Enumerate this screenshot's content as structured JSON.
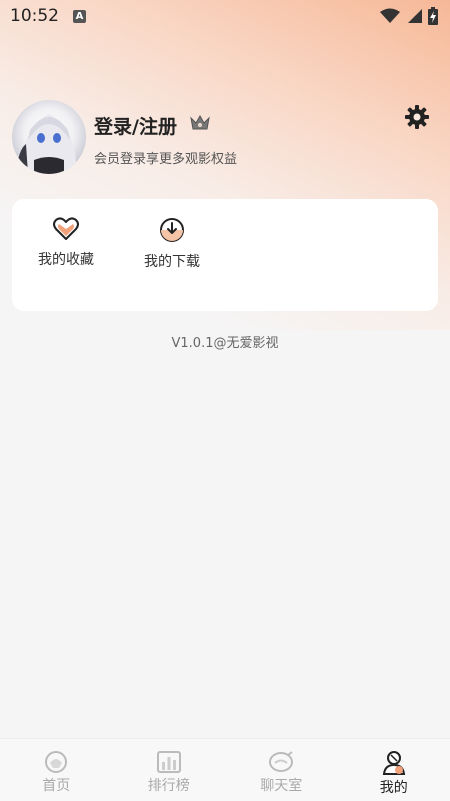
{
  "status_bar": {
    "time": "10:52",
    "notification_glyph": "A"
  },
  "profile": {
    "username": "登录/注册",
    "subtitle": "会员登录享更多观影权益"
  },
  "quick_actions": [
    {
      "label": "我的收藏",
      "icon": "heart-icon"
    },
    {
      "label": "我的下载",
      "icon": "download-icon"
    }
  ],
  "version_text": "V1.0.1@无爱影视",
  "tabs": [
    {
      "label": "首页",
      "icon": "home-icon",
      "active": false
    },
    {
      "label": "排行榜",
      "icon": "ranking-icon",
      "active": false
    },
    {
      "label": "聊天室",
      "icon": "chat-icon",
      "active": false
    },
    {
      "label": "我的",
      "icon": "profile-icon",
      "active": true
    }
  ],
  "colors": {
    "accent": "#f2a27a",
    "active_text": "#222222",
    "inactive_text": "#aaaaaa"
  }
}
